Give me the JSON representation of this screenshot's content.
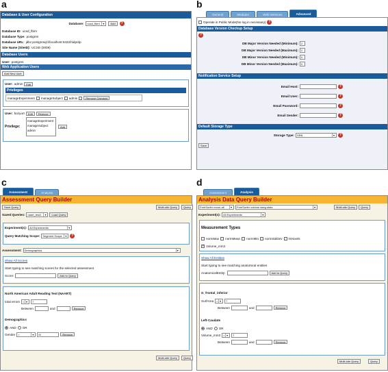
{
  "letters": {
    "a": "a",
    "b": "b",
    "c": "c",
    "d": "d"
  },
  "a": {
    "title": "Database & User Configuration",
    "database_label": "Database:",
    "database_value": "ucsd_fbirn",
    "add": "Add",
    "help": "?",
    "db_id": "Database ID:",
    "db_id_v": "ucsd_fbirn",
    "db_type": "Database Type:",
    "db_type_v": "postgres",
    "db_url": "Database URL:",
    "db_url_v": "jdbc:postgresql://localhost:5432/hidprdp",
    "site": "Site Name (SiteID):",
    "site_v": "UCSD (0009)",
    "db_users": "Database Users",
    "user_label": "User:",
    "user_v": "postgres",
    "web_users": "Web Application Users",
    "add_new_user": "Add New User",
    "user1": "admin",
    "edit": "Edit",
    "privileges": "Privileges",
    "priv1": "manageExperiment",
    "priv2": "manageSubject",
    "priv3": "admin",
    "remove_checked": "Remove Checked",
    "user2": "bozyurt",
    "remove": "Remove",
    "privilege_label": "Privilege:",
    "list": [
      "manageExperiment",
      "manageSubject",
      "admin"
    ]
  },
  "b": {
    "tabs": [
      "General",
      "Mediator",
      "Web Services",
      "Advanced"
    ],
    "public_mode": "Operate in Public Mode(No log in necessary)",
    "version_hdr": "Database Version Checkup Setup",
    "rows": [
      {
        "label": "DB Major Version Needed (Minimum):",
        "value": "2"
      },
      {
        "label": "DB Major Version Needed (Maximum):",
        "value": "2"
      },
      {
        "label": "DB Minor Version Needed (Minimum):",
        "value": "0"
      },
      {
        "label": "DB Minor Version Needed (Maximum):",
        "value": "0"
      }
    ],
    "notif_hdr": "Notification Service Setup",
    "notif": [
      "Email Host:",
      "Email User:",
      "Email Password:",
      "Email Sender:"
    ],
    "storage_hdr": "Default Storage Type",
    "storage_label": "Storage Type:",
    "storage_value": "SRB",
    "save": "Save"
  },
  "c": {
    "tabs": [
      "Assessment",
      "Analysis"
    ],
    "title": "Assessment Query Builder",
    "save_query": "Save Query",
    "multisite": "Multi-site Query",
    "query": "Query",
    "saved_label": "Saved Queries:",
    "saved_value": "naart_test1",
    "load": "Load Query",
    "exp_label": "Experiment(s):",
    "exp_value": "All Experiments",
    "scope_label": "Query Matching Scope:",
    "scope_value": "Segment Scope",
    "assess_label": "Assessment:",
    "assess_value": "Demographics",
    "show_all": "Show All Scores",
    "hint": "Start typing to see matching scores for the selected assessment",
    "score_label": "Score:",
    "add_to_query": "Add to Query",
    "naart_title": "North American Adult Reading Test (NAART)",
    "total_errors": "total errors",
    "eq": "=",
    "val1": "7",
    "between": "Between",
    "and": "and",
    "remove": "Remove",
    "demographics": "Demographics",
    "and_opt": "AND",
    "or_opt": "OR",
    "gender": "Gender",
    "gender_v": "M"
  },
  "d": {
    "tabs": [
      "Assessment",
      "Analysis"
    ],
    "title": "Analysis Data Query Builder",
    "sel1": "FreeSurfer recon-all",
    "sel2": "FreeSurfer volume aseg.stats",
    "multisite": "Multi-site Query",
    "query": "Query",
    "exp_label": "Experiment(s):",
    "exp_value": "All Experiments",
    "mtypes": "Measurement Types",
    "measures": [
      "normMax",
      "normMean",
      "normMin",
      "normStdDev",
      "NVoxels"
    ],
    "volume": "Volume_mm3",
    "show_all": "Show All Entities",
    "hint": "Start typing to see matching anatomical entities",
    "entity_label": "AnatomicalEntity:",
    "add_to_query": "Add to Query",
    "g1": "G_frontal_inferior",
    "surf": "SurfArea",
    "eq": "=",
    "val1": "7",
    "between": "Between",
    "and": "and",
    "remove": "Remove",
    "g2": "Left-Caudate",
    "and_opt": "AND",
    "or_opt": "OR",
    "vol": "Volume_mm3"
  }
}
